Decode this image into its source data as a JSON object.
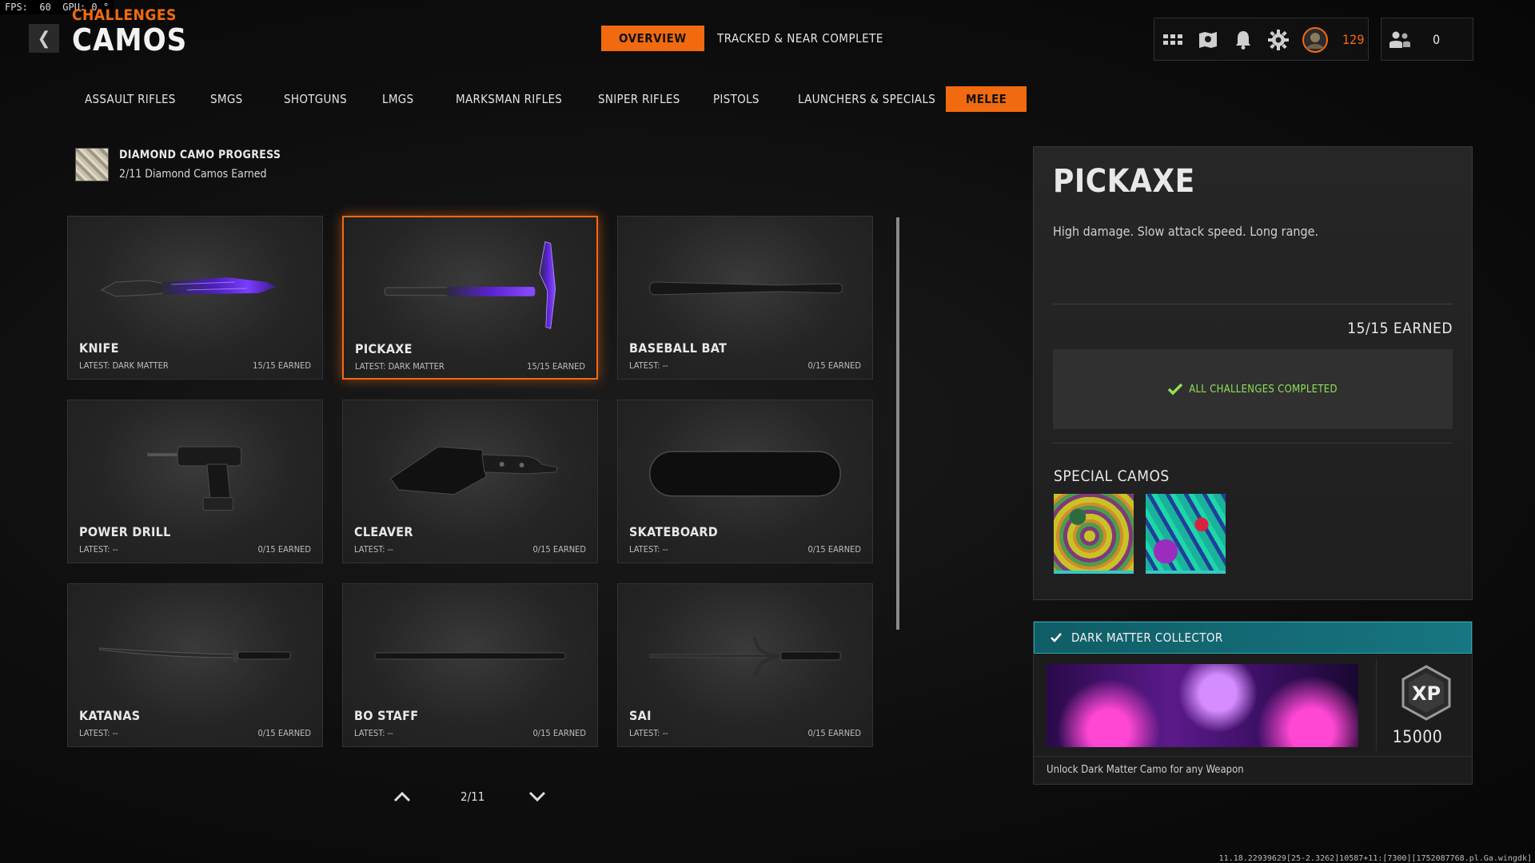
{
  "debug": {
    "fps_text": "FPS:  60  GPU: 0 °"
  },
  "header": {
    "kicker": "CHALLENGES",
    "title": "CAMOS",
    "tabs": [
      {
        "label": "OVERVIEW",
        "active": true
      },
      {
        "label": "TRACKED & NEAR COMPLETE",
        "active": false
      }
    ],
    "currency": "129",
    "party_count": "0"
  },
  "categories": [
    {
      "label": "ASSAULT RIFLES",
      "active": false
    },
    {
      "label": "SMGS",
      "active": false
    },
    {
      "label": "SHOTGUNS",
      "active": false
    },
    {
      "label": "LMGS",
      "active": false
    },
    {
      "label": "MARKSMAN RIFLES",
      "active": false
    },
    {
      "label": "SNIPER RIFLES",
      "active": false
    },
    {
      "label": "PISTOLS",
      "active": false
    },
    {
      "label": "LAUNCHERS & SPECIALS",
      "active": false
    },
    {
      "label": "MELEE",
      "active": true
    }
  ],
  "diamond": {
    "title": "DIAMOND CAMO PROGRESS",
    "subtitle": "2/11 Diamond Camos Earned"
  },
  "weapons": [
    {
      "name": "KNIFE",
      "latest": "LATEST: DARK MATTER",
      "earned": "15/15 EARNED",
      "selected": false,
      "icon": "knife-icon"
    },
    {
      "name": "PICKAXE",
      "latest": "LATEST: DARK MATTER",
      "earned": "15/15 EARNED",
      "selected": true,
      "icon": "pickaxe-icon"
    },
    {
      "name": "BASEBALL BAT",
      "latest": "LATEST: --",
      "earned": "0/15 EARNED",
      "selected": false,
      "icon": "baseball-bat-icon"
    },
    {
      "name": "POWER DRILL",
      "latest": "LATEST: --",
      "earned": "0/15 EARNED",
      "selected": false,
      "icon": "power-drill-icon"
    },
    {
      "name": "CLEAVER",
      "latest": "LATEST: --",
      "earned": "0/15 EARNED",
      "selected": false,
      "icon": "cleaver-icon"
    },
    {
      "name": "SKATEBOARD",
      "latest": "LATEST: --",
      "earned": "0/15 EARNED",
      "selected": false,
      "icon": "skateboard-icon"
    },
    {
      "name": "KATANAS",
      "latest": "LATEST: --",
      "earned": "0/15 EARNED",
      "selected": false,
      "icon": "katana-icon"
    },
    {
      "name": "BO STAFF",
      "latest": "LATEST: --",
      "earned": "0/15 EARNED",
      "selected": false,
      "icon": "bo-staff-icon"
    },
    {
      "name": "SAI",
      "latest": "LATEST: --",
      "earned": "0/15 EARNED",
      "selected": false,
      "icon": "sai-icon"
    }
  ],
  "pager": {
    "text": "2/11"
  },
  "detail": {
    "title": "PICKAXE",
    "description": "High damage.  Slow attack speed. Long range.",
    "earned": "15/15 EARNED",
    "status": "ALL CHALLENGES COMPLETED",
    "special_title": "SPECIAL CAMOS"
  },
  "reward": {
    "title": "DARK MATTER COLLECTOR",
    "xp": "15000",
    "description": "Unlock Dark Matter Camo for any Weapon"
  },
  "build_info": "11.18.22939629[25-2.3262]10587+11:[7300][1752087768.pl.Ga.wingdk]",
  "colors": {
    "accent": "#f26a10",
    "complete_green": "#8fe05a",
    "reward_teal": "#177681"
  }
}
